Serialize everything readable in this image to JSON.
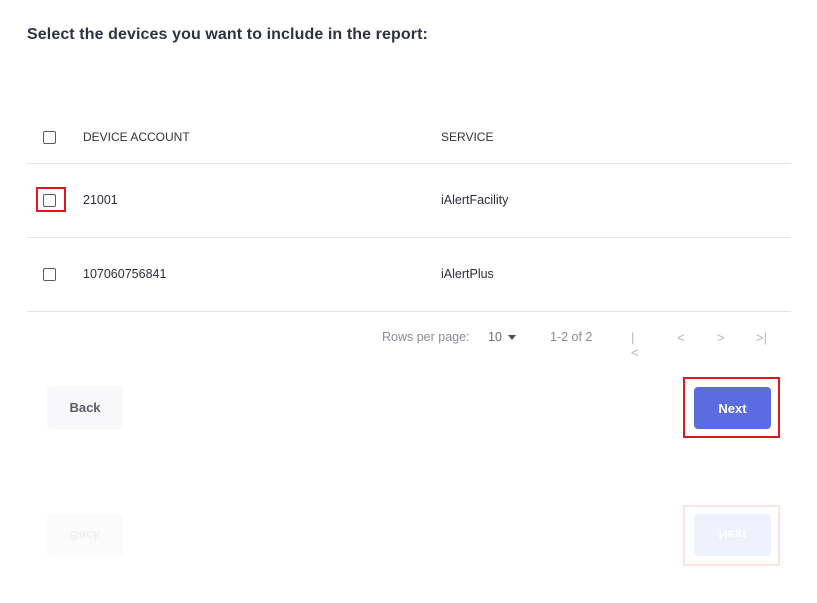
{
  "heading": "Select the devices you want to include in the report:",
  "table": {
    "columns": [
      "DEVICE ACCOUNT",
      "SERVICE"
    ],
    "rows": [
      {
        "account": "21001",
        "service": "iAlertFacility",
        "checked": false
      },
      {
        "account": "107060756841",
        "service": "iAlertPlus",
        "checked": false
      }
    ]
  },
  "pagination": {
    "rows_per_page_label": "Rows per page:",
    "rows_per_page_value": "10",
    "range": "1-2 of 2",
    "first_icon": "first-page-icon",
    "prev_icon": "chevron-left-icon",
    "next_icon": "chevron-right-icon",
    "last_icon": "last-page-icon"
  },
  "buttons": {
    "back": "Back",
    "next": "Next"
  },
  "ghost_buttons": {
    "back": "Back",
    "next": "Next"
  },
  "colors": {
    "accent": "#5b6be0",
    "highlight": "#e0161c"
  }
}
